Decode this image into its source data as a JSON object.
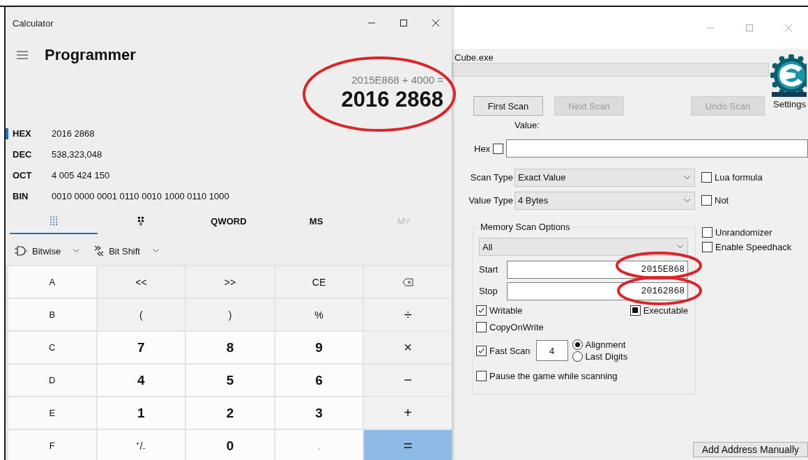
{
  "calculator": {
    "title": "Calculator",
    "mode": "Programmer",
    "expression": "2015E868 + 4000 =",
    "result": "2016 2868",
    "radix": [
      {
        "label": "HEX",
        "value": "2016 2868",
        "selected": true
      },
      {
        "label": "DEC",
        "value": "538,323,048",
        "selected": false
      },
      {
        "label": "OCT",
        "value": "4 005 424 150",
        "selected": false
      },
      {
        "label": "BIN",
        "value": "0010 0000 0001 0110 0010 1000 0110 1000",
        "selected": false
      }
    ],
    "mode_bar": [
      {
        "kind": "keypad",
        "selected": true,
        "disabled": false
      },
      {
        "kind": "bits",
        "selected": false,
        "disabled": false
      },
      {
        "kind": "text",
        "label": "QWORD",
        "selected": false,
        "disabled": false
      },
      {
        "kind": "text",
        "label": "MS",
        "selected": false,
        "disabled": false
      },
      {
        "kind": "text",
        "label": "M˅",
        "selected": false,
        "disabled": true
      }
    ],
    "toolbar": [
      {
        "kind": "gate",
        "label": "Bitwise"
      },
      {
        "kind": "shift",
        "label": "Bit Shift"
      }
    ],
    "keys": [
      [
        {
          "kind": "letter",
          "label": "A"
        },
        {
          "kind": "op",
          "label": "<<"
        },
        {
          "kind": "op",
          "label": ">>"
        },
        {
          "kind": "op",
          "label": "CE"
        },
        {
          "kind": "backspace"
        }
      ],
      [
        {
          "kind": "letter",
          "label": "B"
        },
        {
          "kind": "op",
          "label": "("
        },
        {
          "kind": "op",
          "label": ")"
        },
        {
          "kind": "op",
          "label": "%"
        },
        {
          "kind": "op",
          "label": "÷"
        }
      ],
      [
        {
          "kind": "letter",
          "label": "C"
        },
        {
          "kind": "digit",
          "label": "7"
        },
        {
          "kind": "digit",
          "label": "8"
        },
        {
          "kind": "digit",
          "label": "9"
        },
        {
          "kind": "op",
          "label": "×"
        }
      ],
      [
        {
          "kind": "letter",
          "label": "D"
        },
        {
          "kind": "digit",
          "label": "4"
        },
        {
          "kind": "digit",
          "label": "5"
        },
        {
          "kind": "digit",
          "label": "6"
        },
        {
          "kind": "op",
          "label": "−"
        }
      ],
      [
        {
          "kind": "letter",
          "label": "E"
        },
        {
          "kind": "digit",
          "label": "1"
        },
        {
          "kind": "digit",
          "label": "2"
        },
        {
          "kind": "digit",
          "label": "3"
        },
        {
          "kind": "op",
          "label": "+"
        }
      ],
      [
        {
          "kind": "letter",
          "label": "F"
        },
        {
          "kind": "sign",
          "label": "⁺/₋"
        },
        {
          "kind": "digit",
          "label": "0"
        },
        {
          "kind": "decimal",
          "label": ".",
          "disabled": true
        },
        {
          "kind": "equals",
          "label": "="
        }
      ]
    ]
  },
  "scanner": {
    "process": "Cube.exe",
    "settings_label": "Settings",
    "buttons": [
      {
        "label": "First Scan",
        "disabled": false
      },
      {
        "label": "Next Scan",
        "disabled": true
      },
      {
        "label": "Undo Scan",
        "disabled": true
      }
    ],
    "value_label": "Value:",
    "hex": {
      "label": "Hex",
      "checked": false
    },
    "scan_type": {
      "label": "Scan Type",
      "value": "Exact Value"
    },
    "value_type": {
      "label": "Value Type",
      "value": "4 Bytes"
    },
    "type_options": [
      {
        "label": "Lua formula",
        "checked": false
      },
      {
        "label": "Not",
        "checked": false
      }
    ],
    "memory": {
      "title": "Memory Scan Options",
      "region": "All",
      "start": {
        "label": "Start",
        "value": "2015E868"
      },
      "stop": {
        "label": "Stop",
        "value": "20162868"
      },
      "writable": {
        "label": "Writable",
        "checked": true
      },
      "executable": {
        "label": "Executable",
        "checked": false,
        "indeterminate": true
      },
      "copy_on_write": {
        "label": "CopyOnWrite",
        "checked": false
      },
      "fast_scan": {
        "label": "Fast Scan",
        "checked": true,
        "value": "4"
      },
      "alignment": [
        {
          "label": "Alignment",
          "selected": true
        },
        {
          "label": "Last Digits",
          "selected": false
        }
      ],
      "pause": {
        "label": "Pause the game while scanning",
        "checked": false
      }
    },
    "side_options": [
      {
        "label": "Unrandomizer",
        "checked": false
      },
      {
        "label": "Enable Speedhack",
        "checked": false
      }
    ],
    "add_address": "Add Address Manually"
  }
}
